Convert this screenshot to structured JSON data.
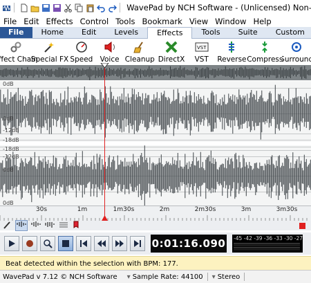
{
  "window": {
    "title": "WavePad by NCH Software - (Unlicensed) Non-commercial home use only"
  },
  "menu": [
    "File",
    "Edit",
    "Effects",
    "Control",
    "Tools",
    "Bookmark",
    "View",
    "Window",
    "Help"
  ],
  "ribbon_tabs": [
    "File",
    "Home",
    "Edit",
    "Levels",
    "Effects",
    "Tools",
    "Suite",
    "Custom"
  ],
  "active_tab": "Effects",
  "toolbar": [
    {
      "label": "Effect Chain",
      "icon": "effect-chain-icon"
    },
    {
      "label": "Special FX",
      "icon": "special-fx-icon"
    },
    {
      "label": "Speed",
      "icon": "speed-icon"
    },
    {
      "label": "Voice",
      "icon": "voice-icon"
    },
    {
      "label": "Cleanup",
      "icon": "cleanup-icon"
    },
    {
      "label": "DirectX",
      "icon": "directx-icon"
    },
    {
      "label": "VST",
      "icon": "vst-icon"
    },
    {
      "label": "Reverse",
      "icon": "reverse-icon"
    },
    {
      "label": "Compress",
      "icon": "compress-icon"
    },
    {
      "label": "Surround",
      "icon": "surround-icon"
    }
  ],
  "waveform": {
    "db_labels": [
      "0dB",
      "0dB",
      "-12dB",
      "-18dB",
      "-18dB",
      "-12dB",
      "0dB",
      "0dB"
    ],
    "timeline": [
      "30s",
      "1m",
      "1m30s",
      "2m",
      "2m30s",
      "3m",
      "3m30s"
    ]
  },
  "transport": {
    "time": "0:01:16.090",
    "meter_scale": "-45 -42 -39 -36 -33 -30 -27"
  },
  "status_message": "Beat detected within the selection with BPM: 177.",
  "footer": {
    "version": "WavePad v 7.12 © NCH Software",
    "sample_rate": "Sample Rate: 44100",
    "channels": "Stereo"
  },
  "colors": {
    "accent": "#2b5797",
    "playhead": "#e02020",
    "waveform": "#3d4347",
    "status_bg": "#fdf2c0"
  }
}
